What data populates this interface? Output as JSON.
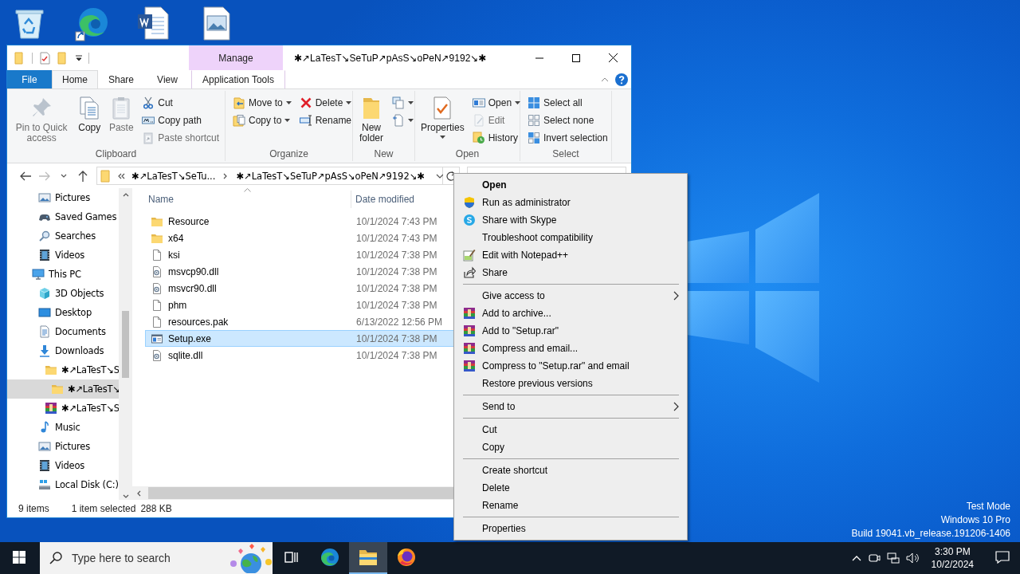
{
  "desktop": {
    "icons": [
      {
        "kind": "recycle-bin"
      },
      {
        "kind": "edge"
      },
      {
        "kind": "word"
      },
      {
        "kind": "image"
      }
    ],
    "notice": [
      "Test Mode",
      "Windows 10 Pro",
      "Build 19041.vb_release.191206-1406"
    ]
  },
  "window": {
    "title": "✱↗LaTesT↘SeTuP↗pAsS↘oPeN↗9192↘✱",
    "context_tab": "Manage"
  },
  "ribbon_tabs": [
    {
      "label": "File",
      "kind": "file",
      "selected": false
    },
    {
      "label": "Home",
      "kind": "tab",
      "selected": true
    },
    {
      "label": "Share",
      "kind": "tab",
      "selected": false
    },
    {
      "label": "View",
      "kind": "tab",
      "selected": false
    },
    {
      "label": "Application Tools",
      "kind": "context",
      "selected": false
    }
  ],
  "ribbon_groups": [
    {
      "label": "Clipboard",
      "large": [
        {
          "label": "Pin to Quick access",
          "kind": "pin",
          "disabled": true,
          "dropdown": false
        },
        {
          "label": "Copy",
          "kind": "copy",
          "disabled": false,
          "dropdown": false
        },
        {
          "label": "Paste",
          "kind": "paste",
          "disabled": true,
          "dropdown": false
        }
      ],
      "columns": [
        [
          {
            "label": "Cut",
            "kind": "cut",
            "disabled": false,
            "dropdown": false
          },
          {
            "label": "Copy path",
            "kind": "copy-path",
            "disabled": false,
            "dropdown": false
          },
          {
            "label": "Paste shortcut",
            "kind": "paste-shortcut",
            "disabled": true,
            "dropdown": false
          }
        ]
      ]
    },
    {
      "label": "Organize",
      "columns": [
        [
          {
            "label": "Move to",
            "kind": "move-to",
            "disabled": false,
            "dropdown": true
          },
          {
            "label": "Copy to",
            "kind": "copy-to",
            "disabled": false,
            "dropdown": true
          }
        ],
        [
          {
            "label": "Delete",
            "kind": "delete",
            "disabled": false,
            "dropdown": true
          },
          {
            "label": "Rename",
            "kind": "rename",
            "disabled": false,
            "dropdown": false
          }
        ]
      ]
    },
    {
      "label": "New",
      "large": [
        {
          "label": "New folder",
          "kind": "new-folder",
          "disabled": false,
          "dropdown": false
        }
      ],
      "columns": [
        [
          {
            "kind": "new-item",
            "disabled": false,
            "dropdown": true
          },
          {
            "kind": "easy-access",
            "disabled": false,
            "dropdown": true
          }
        ]
      ]
    },
    {
      "label": "Open",
      "large": [
        {
          "label": "Properties",
          "kind": "properties",
          "disabled": false,
          "dropdown": true
        }
      ],
      "columns": [
        [
          {
            "label": "Open",
            "kind": "open",
            "disabled": false,
            "dropdown": true
          },
          {
            "label": "Edit",
            "kind": "edit",
            "disabled": true,
            "dropdown": false
          },
          {
            "label": "History",
            "kind": "history",
            "disabled": false,
            "dropdown": false
          }
        ]
      ]
    },
    {
      "label": "Select",
      "columns": [
        [
          {
            "label": "Select all",
            "kind": "select-all",
            "disabled": false,
            "dropdown": false
          },
          {
            "label": "Select none",
            "kind": "select-none",
            "disabled": false,
            "dropdown": false
          },
          {
            "label": "Invert selection",
            "kind": "invert",
            "disabled": false,
            "dropdown": false
          }
        ]
      ]
    }
  ],
  "address": {
    "back_disabled": false,
    "forward_disabled": true,
    "breadcrumbs": [
      "✱↗LaTesT↘SeTu...",
      "✱↗LaTesT↘SeTuP↗pAsS↘oPeN↗9192↘✱"
    ]
  },
  "nav_tree": [
    {
      "children": [
        {
          "label": "Pictures",
          "kind": "pictures",
          "selected": false
        },
        {
          "label": "Saved Games",
          "kind": "games",
          "selected": false
        },
        {
          "label": "Searches",
          "kind": "search",
          "selected": false
        },
        {
          "label": "Videos",
          "kind": "videos",
          "selected": false
        }
      ]
    },
    {
      "label": "This PC",
      "kind": "pc",
      "selected": false,
      "children": [
        {
          "label": "3D Objects",
          "kind": "cube",
          "selected": false
        },
        {
          "label": "Desktop",
          "kind": "desktop",
          "selected": false
        },
        {
          "label": "Documents",
          "kind": "documents",
          "selected": false
        },
        {
          "label": "Downloads",
          "kind": "downloads",
          "selected": false,
          "children": [
            {
              "label": "✱↗LaTesT↘S",
              "kind": "folder",
              "selected": false,
              "children": [
                {
                  "label": "✱↗LaTesT↘",
                  "kind": "folder",
                  "selected": true
                }
              ]
            },
            {
              "label": "✱↗LaTesT↘S",
              "kind": "archive",
              "selected": false
            }
          ]
        },
        {
          "label": "Music",
          "kind": "music",
          "selected": false
        },
        {
          "label": "Pictures",
          "kind": "pictures",
          "selected": false
        },
        {
          "label": "Videos",
          "kind": "videos",
          "selected": false
        },
        {
          "label": "Local Disk (C:)",
          "kind": "disk",
          "selected": false
        }
      ]
    }
  ],
  "columns": [
    "Name",
    "Date modified"
  ],
  "files": [
    {
      "name": "Resource",
      "date": "10/1/2024 7:43 PM",
      "kind": "folder",
      "selected": false
    },
    {
      "name": "x64",
      "date": "10/1/2024 7:43 PM",
      "kind": "folder",
      "selected": false
    },
    {
      "name": "ksi",
      "date": "10/1/2024 7:38 PM",
      "kind": "file",
      "selected": false
    },
    {
      "name": "msvcp90.dll",
      "date": "10/1/2024 7:38 PM",
      "kind": "dll",
      "selected": false
    },
    {
      "name": "msvcr90.dll",
      "date": "10/1/2024 7:38 PM",
      "kind": "dll",
      "selected": false
    },
    {
      "name": "phm",
      "date": "10/1/2024 7:38 PM",
      "kind": "file",
      "selected": false
    },
    {
      "name": "resources.pak",
      "date": "6/13/2022 12:56 PM",
      "kind": "file",
      "selected": false
    },
    {
      "name": "Setup.exe",
      "date": "10/1/2024 7:38 PM",
      "kind": "exe",
      "selected": true
    },
    {
      "name": "sqlite.dll",
      "date": "10/1/2024 7:38 PM",
      "kind": "dll",
      "selected": false
    }
  ],
  "status_bar": {
    "count": "9 items",
    "selection": "1 item selected",
    "size": "288 KB"
  },
  "context_menu": [
    [
      {
        "label": "Open",
        "kind": "plain",
        "default": true,
        "submenu": false
      },
      {
        "label": "Run as administrator",
        "kind": "shield",
        "default": false,
        "submenu": false
      },
      {
        "label": "Share with Skype",
        "kind": "skype",
        "default": false,
        "submenu": false
      },
      {
        "label": "Troubleshoot compatibility",
        "kind": "plain",
        "default": false,
        "submenu": false
      },
      {
        "label": "Edit with Notepad++",
        "kind": "notepad",
        "default": false,
        "submenu": false
      },
      {
        "label": "Share",
        "kind": "share",
        "default": false,
        "submenu": false
      }
    ],
    [
      {
        "label": "Give access to",
        "kind": "plain",
        "default": false,
        "submenu": true
      },
      {
        "label": "Add to archive...",
        "kind": "winrar",
        "default": false,
        "submenu": false
      },
      {
        "label": "Add to \"Setup.rar\"",
        "kind": "winrar",
        "default": false,
        "submenu": false
      },
      {
        "label": "Compress and email...",
        "kind": "winrar",
        "default": false,
        "submenu": false
      },
      {
        "label": "Compress to \"Setup.rar\" and email",
        "kind": "winrar",
        "default": false,
        "submenu": false
      },
      {
        "label": "Restore previous versions",
        "kind": "plain",
        "default": false,
        "submenu": false
      }
    ],
    [
      {
        "label": "Send to",
        "kind": "plain",
        "default": false,
        "submenu": true
      }
    ],
    [
      {
        "label": "Cut",
        "kind": "plain",
        "default": false,
        "submenu": false
      },
      {
        "label": "Copy",
        "kind": "plain",
        "default": false,
        "submenu": false
      }
    ],
    [
      {
        "label": "Create shortcut",
        "kind": "plain",
        "default": false,
        "submenu": false
      },
      {
        "label": "Delete",
        "kind": "plain",
        "default": false,
        "submenu": false
      },
      {
        "label": "Rename",
        "kind": "plain",
        "default": false,
        "submenu": false
      }
    ],
    [
      {
        "label": "Properties",
        "kind": "plain",
        "default": false,
        "submenu": false
      }
    ]
  ],
  "taskbar": {
    "search_placeholder": "Type here to search",
    "apps": [
      {
        "kind": "task-view",
        "selected": false
      },
      {
        "kind": "edge",
        "selected": false
      },
      {
        "kind": "explorer",
        "selected": true
      },
      {
        "kind": "firefox",
        "selected": false
      }
    ],
    "time": "3:30 PM",
    "date": "10/2/2024"
  }
}
